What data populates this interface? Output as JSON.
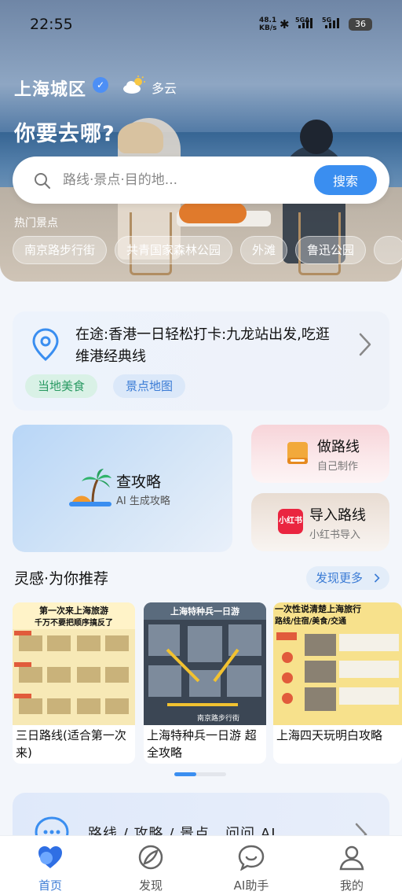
{
  "status_bar": {
    "time": "22:55",
    "net_speed_value": "48.1",
    "net_speed_unit": "KB/s",
    "sim1_label": "5GA",
    "sim2_label": "5G",
    "battery": "36"
  },
  "hero": {
    "city": "上海城区",
    "weather": "多云",
    "headline": "你要去哪?",
    "search": {
      "placeholder": "路线·景点·目的地...",
      "button": "搜索"
    },
    "hot_title": "热门景点",
    "hot_spots": [
      "南京路步行街",
      "共青国家森林公园",
      "外滩",
      "鲁迅公园"
    ]
  },
  "trip": {
    "text": "在途:香港一日轻松打卡:九龙站出发,吃逛维港经典线",
    "tags": [
      "当地美食",
      "景点地图"
    ]
  },
  "tools": {
    "guide": {
      "title": "查攻略",
      "subtitle": "AI 生成攻略"
    },
    "make_route": {
      "title": "做路线",
      "subtitle": "自己制作"
    },
    "import_route": {
      "title": "导入路线",
      "subtitle": "小红书导入",
      "badge": "小红书"
    }
  },
  "inspiration": {
    "title": "灵感·为你推荐",
    "more": "发现更多",
    "cards": [
      {
        "title": "三日路线(适合第一次来)",
        "img_heading": "第一次来上海旅游",
        "img_sub": "千万不要把顺序搞反了"
      },
      {
        "title": "上海特种兵一日游 超全攻略",
        "img_heading": "上海特种兵一日游",
        "img_sub": "南京路步行街"
      },
      {
        "title": "上海四天玩明白攻略",
        "img_heading": "一次性说清楚上海旅行",
        "img_sub": "路线/住宿/美食/交通"
      }
    ]
  },
  "ask": {
    "text": "路线 / 攻略 / 景点 , 问问 AI"
  },
  "tabbar": {
    "items": [
      {
        "label": "首页"
      },
      {
        "label": "发现"
      },
      {
        "label": "AI助手"
      },
      {
        "label": "我的"
      }
    ]
  }
}
